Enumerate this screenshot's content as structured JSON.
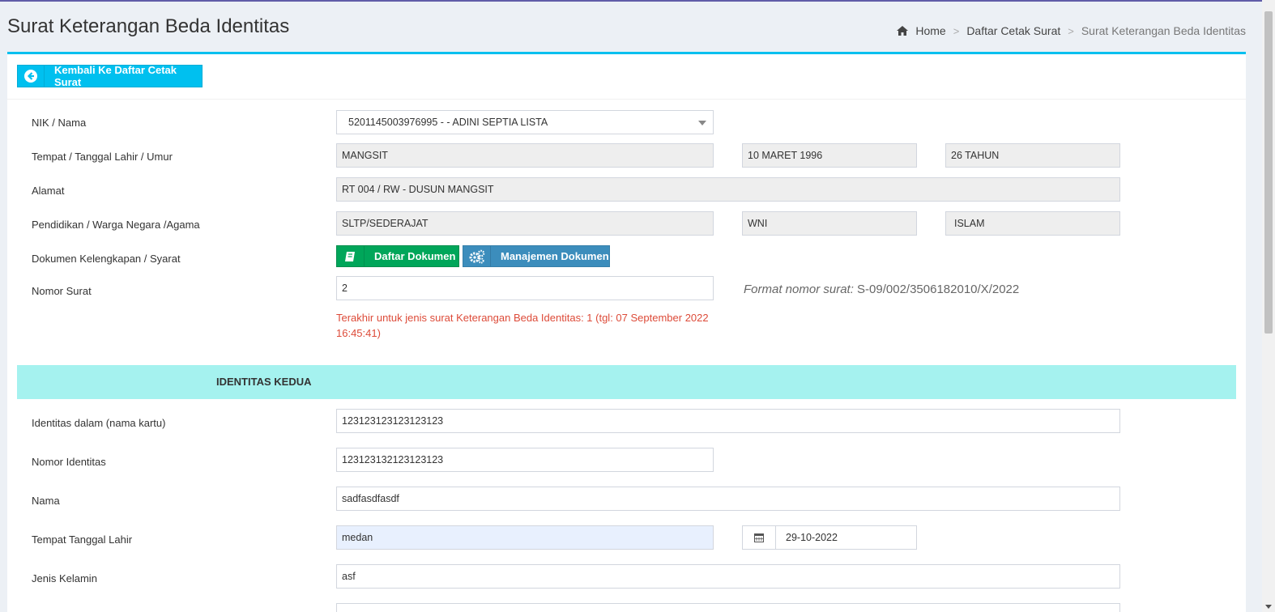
{
  "header": {
    "title": "Surat Keterangan Beda Identitas",
    "breadcrumb": {
      "home": "Home",
      "sep": ">",
      "list": "Daftar Cetak Surat",
      "current": "Surat Keterangan Beda Identitas"
    }
  },
  "back_button": {
    "label": "Kembali Ke Daftar Cetak Surat"
  },
  "form": {
    "nik_label": "NIK / Nama",
    "nik_value": "5201145003976995 - - ADINI SEPTIA LISTA",
    "ttl_label": "Tempat / Tanggal Lahir / Umur",
    "tempat": "MANGSIT",
    "tanggal": "10 MARET 1996",
    "umur": "26 TAHUN",
    "alamat_label": "Alamat",
    "alamat": "RT 004 / RW - DUSUN MANGSIT",
    "pendidikan_label": "Pendidikan / Warga Negara /Agama",
    "pendidikan": "SLTP/SEDERAJAT",
    "warga": "WNI",
    "agama": "ISLAM",
    "dokumen_label": "Dokumen Kelengkapan / Syarat",
    "btn_daftar": "Daftar Dokumen",
    "btn_manajemen": "Manajemen Dokumen",
    "nomor_label": "Nomor Surat",
    "nomor_value": "2",
    "format_label": "Format nomor surat:",
    "format_value": "S-09/002/3506182010/X/2022",
    "warning": "Terakhir untuk jenis surat Keterangan Beda Identitas: 1 (tgl: 07 September 2022 16:45:41)"
  },
  "section": {
    "title": "IDENTITAS KEDUA"
  },
  "second": {
    "identitas_label": "Identitas dalam (nama kartu)",
    "identitas_value": "123123123123123123",
    "nomor_label": "Nomor Identitas",
    "nomor_value": "123123132123123123",
    "nama_label": "Nama",
    "nama_value": "sadfasdfasdf",
    "ttl_label": "Tempat Tanggal Lahir",
    "tempat_value": "medan",
    "tanggal_value": "29-10-2022",
    "jk_label": "Jenis Kelamin",
    "jk_value": "asf"
  },
  "colors": {
    "accent": "#00c0ef",
    "success": "#00a65a",
    "primary": "#3c8dbc",
    "section": "#a5f2ef",
    "danger": "#dd4b39"
  }
}
